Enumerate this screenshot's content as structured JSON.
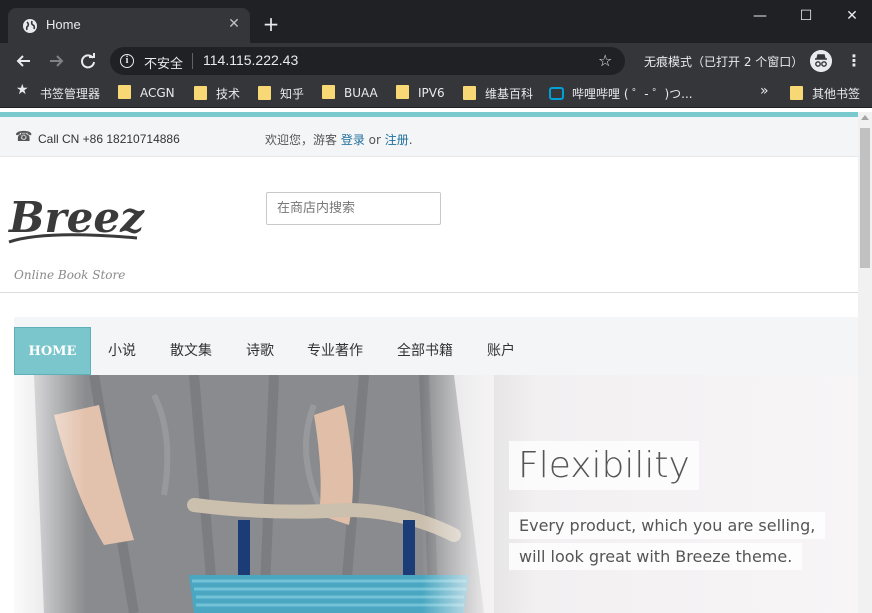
{
  "browser": {
    "tab_title": "Home",
    "new_tab_symbol": "+",
    "security_label": "不安全",
    "url": "114.115.222.43",
    "incognito_label": "无痕模式（已打开 2 个窗口）",
    "bookmarks": [
      {
        "label": "书签管理器",
        "icon": "star-icon"
      },
      {
        "label": "ACGN",
        "icon": "folder-icon"
      },
      {
        "label": "技术",
        "icon": "folder-icon"
      },
      {
        "label": "知乎",
        "icon": "folder-icon"
      },
      {
        "label": "BUAA",
        "icon": "folder-icon"
      },
      {
        "label": "IPV6",
        "icon": "folder-icon"
      },
      {
        "label": "维基百科",
        "icon": "folder-icon"
      },
      {
        "label": "哔哩哔哩 ( ゜- ゜)つ...",
        "icon": "bilibili-icon"
      }
    ],
    "overflow_symbol": "»",
    "other_bookmarks": "其他书签"
  },
  "page": {
    "topbar": {
      "phone": "Call CN +86 18210714886",
      "welcome_prefix": "欢迎您，游客 ",
      "login": "登录",
      "or": " or ",
      "register": "注册",
      "period": "."
    },
    "logo_text": "Breeze",
    "tagline": "Online Book Store",
    "search_placeholder": "在商店内搜索",
    "nav": [
      "HOME",
      "小说",
      "散文集",
      "诗歌",
      "专业著作",
      "全部书籍",
      "账户"
    ],
    "hero": {
      "title": "Flexibility",
      "line1": "Every product, which you are selling,",
      "line2": "will look great with Breeze theme."
    }
  },
  "colors": {
    "accent": "#7ac6cc",
    "link": "#1f6f9c",
    "chrome_dark": "#202124",
    "chrome_mid": "#35363a"
  }
}
